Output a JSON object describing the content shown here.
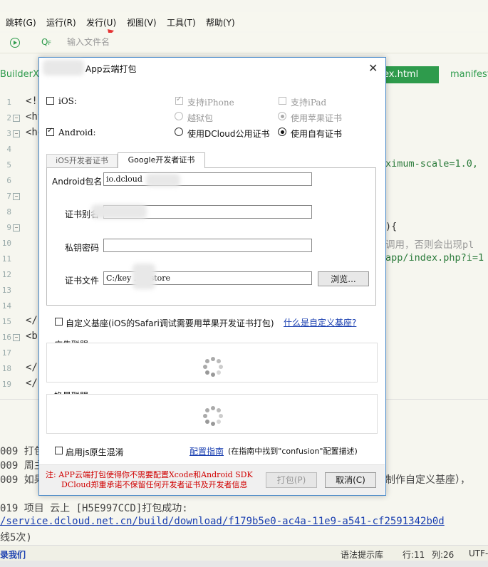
{
  "menu": {
    "items": [
      "跳转(G)",
      "运行(R)",
      "发行(U)",
      "视图(V)",
      "工具(T)",
      "帮助(Y)"
    ]
  },
  "toolbar": {
    "run_icon": "run-icon",
    "search_prefix": "Q",
    "search_suffix": "F",
    "search_placeholder": "输入文件名"
  },
  "tabs": {
    "left": "BuilderX",
    "active": "ex.html",
    "right": "manifest"
  },
  "editor": {
    "line_numbers": [
      "1",
      "2",
      "3",
      "4",
      "5",
      "6",
      "7",
      "8",
      "9",
      "10",
      "11",
      "12",
      "13",
      "14",
      "15",
      "16",
      "17",
      "18",
      "19"
    ],
    "code_left": [
      "<!",
      "<ht",
      "<he",
      "</",
      "<b",
      "</",
      "</"
    ],
    "code_right": {
      "line5": "ximum-scale=1.0,",
      "line9": "){",
      "line10": "调用，否则会出现pl",
      "line11": "app/index.php?i=1"
    }
  },
  "console": {
    "lines": [
      "009 打包",
      "009 周主",
      "009 如果",
      "019 项目 云上 [H5E997CCD]打包成功:",
      "/service.dcloud.net.cn/build/download/f179b5e0-ac4a-11e9-a541-cf2591342b0d",
      "线5次)"
    ],
    "right_fragment": "制作自定义基座），"
  },
  "statusbar": {
    "left_link": "录我们",
    "syntax_hint": "语法提示库",
    "line": "行:11",
    "col": "列:26",
    "encoding": "UTF-"
  },
  "dialog": {
    "title": "App云端打包",
    "platforms": {
      "ios_label": "iOS:",
      "ios_checked": false,
      "support_iphone": "支持iPhone",
      "support_ipad": "支持iPad",
      "jailbreak": "越狱包",
      "use_apple_cert": "使用苹果证书",
      "android_label": "Android:",
      "android_checked": true,
      "use_dcloud_cert": "使用DCloud公用证书",
      "use_own_cert": "使用自有证书"
    },
    "cert_tabs": [
      "iOS开发者证书",
      "Google开发者证书"
    ],
    "form": {
      "package_label": "Android包名",
      "package_value": "io.dcloud",
      "alias_label": "证书别名",
      "alias_value": "",
      "password_label": "私钥密码",
      "password_value": "",
      "file_label": "证书文件",
      "file_value": "C:/key   .keystore",
      "browse_label": "浏览..."
    },
    "custom_base_label": "自定义基座(iOS的Safari调试需要用苹果开发证书打包)",
    "custom_base_link": "什么是自定义基座?",
    "ad_group_label": "广告联盟",
    "swap_group_label": "换量联盟",
    "confuse_label": "启用js原生混淆",
    "config_link": "配置指南",
    "config_hint": "(在指南中找到\"confusion\"配置描述)",
    "note_line1": "注: APP云端打包使得你不需要配置Xcode和Android SDK",
    "note_line2": "DCloud郑重承诺不保留任何开发者证书及开发者信息",
    "pack_button": "打包(P)",
    "cancel_button": "取消(C)",
    "close_icon": "close-icon",
    "spinner_icon": "loading-spinner-icon"
  },
  "colors": {
    "accent_green": "#2e9b4c",
    "dialog_border": "#4a8ac9",
    "note_red": "#d00000",
    "link_blue": "#1a3fb0"
  }
}
